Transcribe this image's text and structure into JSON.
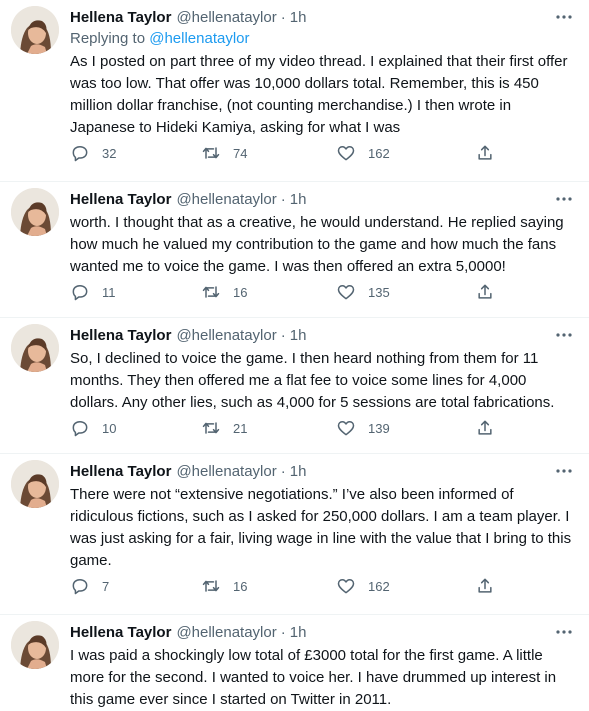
{
  "icons": {
    "more": "more-horizontal-icon",
    "reply": "reply-icon",
    "retweet": "retweet-icon",
    "like": "heart-icon",
    "share": "share-icon"
  },
  "colors": {
    "accent": "#1d9bf0",
    "muted": "#536471",
    "text": "#0f1419"
  },
  "tweets": [
    {
      "name": "Hellena Taylor",
      "handle": "@hellenataylor",
      "sep": "·",
      "time": "1h",
      "replying_prefix": "Replying to ",
      "replying_to": "@hellenataylor",
      "text": "As I posted on part three of my video thread.  I explained that their first offer was too low.  That offer was 10,000 dollars total.  Remember, this is 450 million dollar franchise, (not counting merchandise.)  I then wrote in Japanese to Hideki Kamiya, asking for what I was",
      "replies": "32",
      "retweets": "74",
      "likes": "162"
    },
    {
      "name": "Hellena Taylor",
      "handle": "@hellenataylor",
      "sep": "·",
      "time": "1h",
      "text": "worth.  I thought that as a creative, he would understand.  He replied saying how much he valued my contribution to the game and how much the fans wanted me to voice the game.  I was then offered an extra 5,0000!",
      "replies": "11",
      "retweets": "16",
      "likes": "135"
    },
    {
      "name": "Hellena Taylor",
      "handle": "@hellenataylor",
      "sep": "·",
      "time": "1h",
      "text": "So, I declined to voice the game.  I then heard nothing from them for 11 months.  They then offered me a flat fee to voice some lines for 4,000 dollars.  Any other lies, such as 4,000 for 5 sessions are total fabrications.",
      "replies": "10",
      "retweets": "21",
      "likes": "139"
    },
    {
      "name": "Hellena Taylor",
      "handle": "@hellenataylor",
      "sep": "·",
      "time": "1h",
      "text": "There were not “extensive negotiations.”  I’ve also been informed of ridiculous fictions, such as I asked for 250,000 dollars.  I am a team player.  I was just asking for a fair, living wage in line with the value that I bring to this game.",
      "replies": "7",
      "retweets": "16",
      "likes": "162"
    },
    {
      "name": "Hellena Taylor",
      "handle": "@hellenataylor",
      "sep": "·",
      "time": "1h",
      "text": "I was paid a shockingly low total of £3000 total for the first game.  A little more for the second.  I wanted to voice her.  I have drummed up interest in this game ever since I started on Twitter in 2011."
    }
  ]
}
